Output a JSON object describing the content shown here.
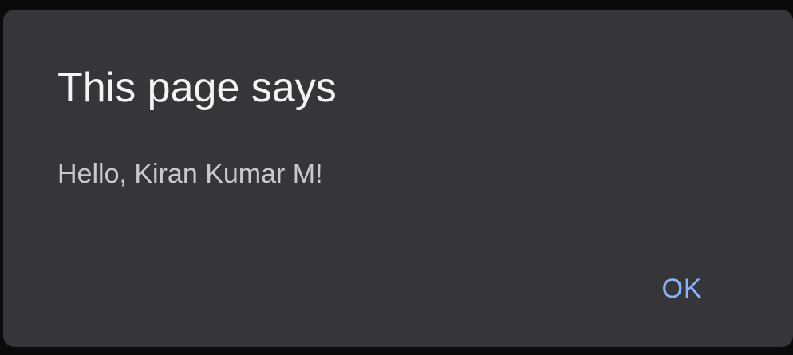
{
  "dialog": {
    "title": "This page says",
    "message": "Hello, Kiran Kumar M!",
    "ok_label": "OK"
  },
  "colors": {
    "backdrop": "#0b0b0c",
    "dialog_background": "#36353a",
    "title_text": "#f4f4f5",
    "message_text": "#c9c9cc",
    "button_text": "#8ab4f8"
  }
}
